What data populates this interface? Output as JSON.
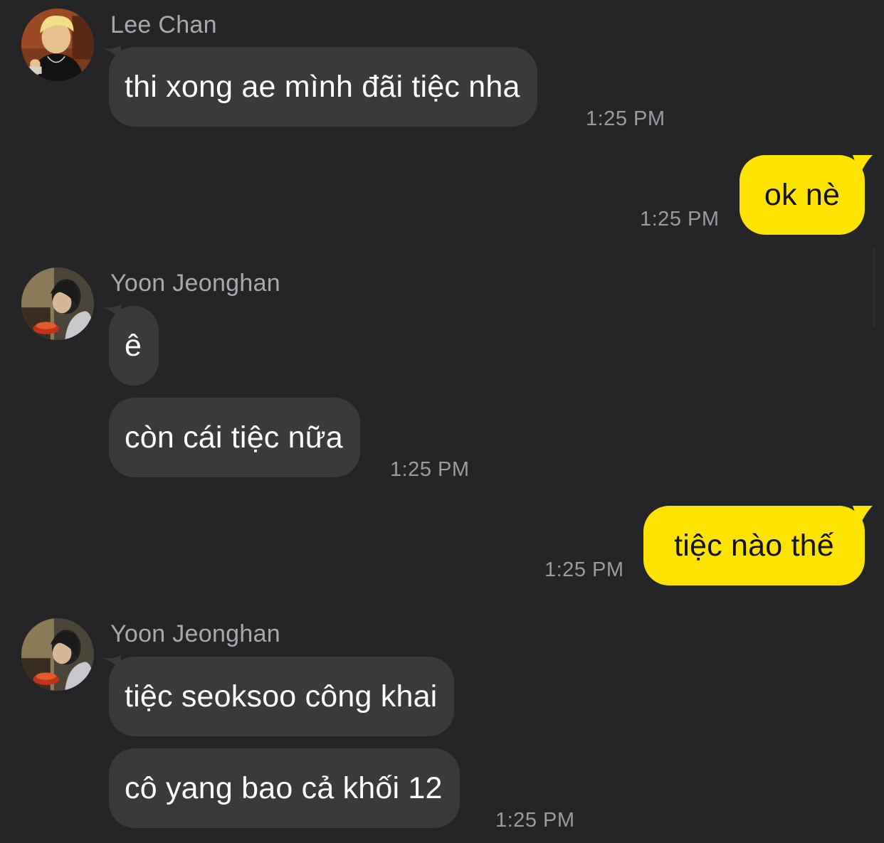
{
  "chat": {
    "messages": [
      {
        "sender": "Lee Chan",
        "avatar": "lee-chan-avatar",
        "texts": [
          "thi xong ae mình đãi tiệc nha"
        ],
        "time": "1:25 PM"
      },
      {
        "outgoing": true,
        "texts": [
          "ok nè"
        ],
        "time": "1:25 PM"
      },
      {
        "sender": "Yoon Jeonghan",
        "avatar": "yoon-jeonghan-avatar",
        "texts": [
          "ê",
          "còn cái tiệc nữa"
        ],
        "time": "1:25 PM"
      },
      {
        "outgoing": true,
        "texts": [
          "tiệc nào thế"
        ],
        "time": "1:25 PM"
      },
      {
        "sender": "Yoon Jeonghan",
        "avatar": "yoon-jeonghan-avatar",
        "texts": [
          "tiệc seoksoo công khai",
          "cô yang bao cả khối 12"
        ],
        "time": "1:25 PM"
      }
    ]
  },
  "colors": {
    "background": "#252527",
    "incoming_bubble": "#3a3a3c",
    "outgoing_bubble": "#fde400",
    "incoming_text": "#ffffff",
    "outgoing_text": "#131313",
    "sender_name": "#a9a9ad",
    "timestamp": "#9b9b9f"
  }
}
